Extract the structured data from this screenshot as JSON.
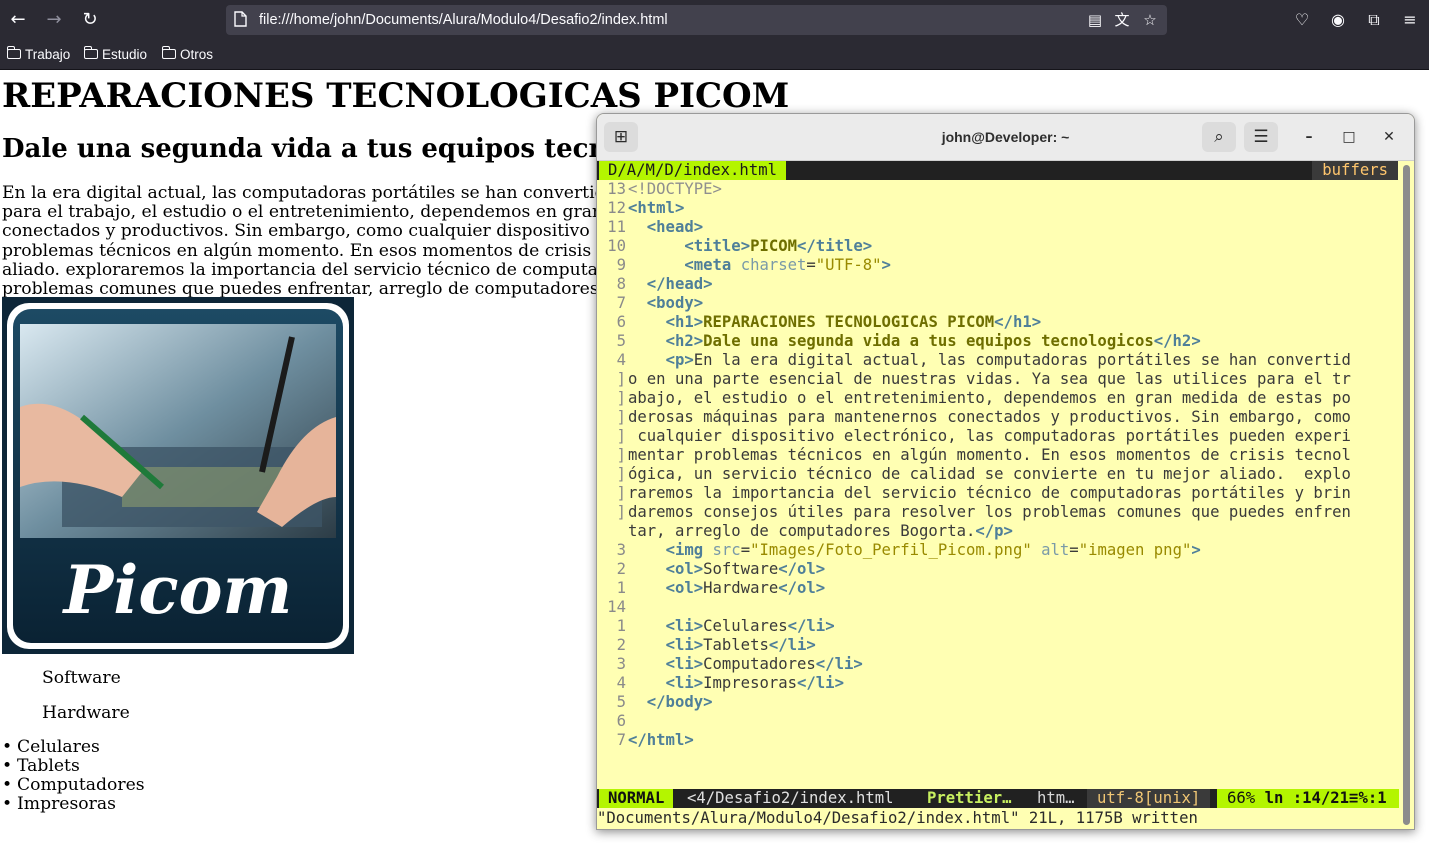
{
  "browser": {
    "url": "file:///home/john/Documents/Alura/Modulo4/Desafio2/index.html",
    "bookmarks": [
      "Trabajo",
      "Estudio",
      "Otros"
    ]
  },
  "page": {
    "h1": "REPARACIONES TECNOLOGICAS PICOM",
    "h2": "Dale una segunda vida a tus equipos tecnologicos",
    "paragraph": "En la era digital actual, las computadoras portátiles se han convertido en una parte esencial de nuestras vidas. Ya sea que las utilices para el trabajo, el estudio o el entretenimiento, dependemos en gran medida de estas poderosas máquinas para mantenernos conectados y productivos. Sin embargo, como cualquier dispositivo electrónico, las computadoras portátiles pueden experimentar problemas técnicos en algún momento. En esos momentos de crisis tecnológica, un servicio técnico de calidad se convierte en tu mejor aliado. exploraremos la importancia del servicio técnico de computadoras portátiles y brindaremos consejos útiles para resolver los problemas comunes que puedes enfrentar, arreglo de computadores Bogorta.",
    "logo_text": "Picom",
    "ordered": [
      "Software",
      "Hardware"
    ],
    "bullets": [
      "Celulares",
      "Tablets",
      "Computadores",
      "Impresoras"
    ]
  },
  "terminal": {
    "title": "john@Developer: ~",
    "tab_name": "D/A/M/D/index.html",
    "buffers_label": "buffers",
    "lines": [
      {
        "n": "13",
        "code": "<!DOCTYPE>"
      },
      {
        "n": "12",
        "code": "<html>"
      },
      {
        "n": "11",
        "code": "  <head>"
      },
      {
        "n": "10",
        "code": "      <title>PICOM</title>"
      },
      {
        "n": "9",
        "code": "      <meta charset=\"UTF-8\">"
      },
      {
        "n": "8",
        "code": "  </head>"
      },
      {
        "n": "7",
        "code": "  <body>"
      },
      {
        "n": "6",
        "code": "    <h1>REPARACIONES TECNOLOGICAS PICOM</h1>"
      },
      {
        "n": "5",
        "code": "    <h2>Dale una segunda vida a tus equipos tecnologicos</h2>"
      },
      {
        "n": "4",
        "code": "    <p>En la era digital actual, las computadoras portátiles se han convertid"
      },
      {
        "n": "]",
        "code": "o en una parte esencial de nuestras vidas. Ya sea que las utilices para el tr"
      },
      {
        "n": "]",
        "code": "abajo, el estudio o el entretenimiento, dependemos en gran medida de estas po"
      },
      {
        "n": "]",
        "code": "derosas máquinas para mantenernos conectados y productivos. Sin embargo, como"
      },
      {
        "n": "]",
        "code": " cualquier dispositivo electrónico, las computadoras portátiles pueden experi"
      },
      {
        "n": "]",
        "code": "mentar problemas técnicos en algún momento. En esos momentos de crisis tecnol"
      },
      {
        "n": "]",
        "code": "ógica, un servicio técnico de calidad se convierte en tu mejor aliado.  explo"
      },
      {
        "n": "]",
        "code": "raremos la importancia del servicio técnico de computadoras portátiles y brin"
      },
      {
        "n": "]",
        "code": "daremos consejos útiles para resolver los problemas comunes que puedes enfren"
      },
      {
        "n": "",
        "code": "tar, arreglo de computadores Bogorta.</p>"
      },
      {
        "n": "3",
        "code": "    <img src=\"Images/Foto_Perfil_Picom.png\" alt=\"imagen png\">"
      },
      {
        "n": "2",
        "code": "    <ol>Software</ol>"
      },
      {
        "n": "1",
        "code": "    <ol>Hardware</ol>"
      },
      {
        "n": "14",
        "code": ""
      },
      {
        "n": "1",
        "code": "    <li>Celulares</li>"
      },
      {
        "n": "2",
        "code": "    <li>Tablets</li>"
      },
      {
        "n": "3",
        "code": "    <li>Computadores</li>"
      },
      {
        "n": "4",
        "code": "    <li>Impresoras</li>"
      },
      {
        "n": "5",
        "code": "  </body>"
      },
      {
        "n": "6",
        "code": ""
      },
      {
        "n": "7",
        "code": "</html>"
      }
    ],
    "status": {
      "mode": "NORMAL",
      "file": "<4/Desafio2/index.html",
      "plugin": "Prettier…",
      "filetype": "htm…",
      "encoding": "utf-8[unix]",
      "percent": "66%",
      "position": "ln :14/21≡%:1"
    },
    "cmdline": "\"Documents/Alura/Modulo4/Desafio2/index.html\" 21L, 1175B written"
  },
  "colors": {
    "browser_chrome": "#2b2a33",
    "terminal_bg": "#ffffb3",
    "vim_accent": "#b4f500",
    "vim_bar": "#212121"
  }
}
